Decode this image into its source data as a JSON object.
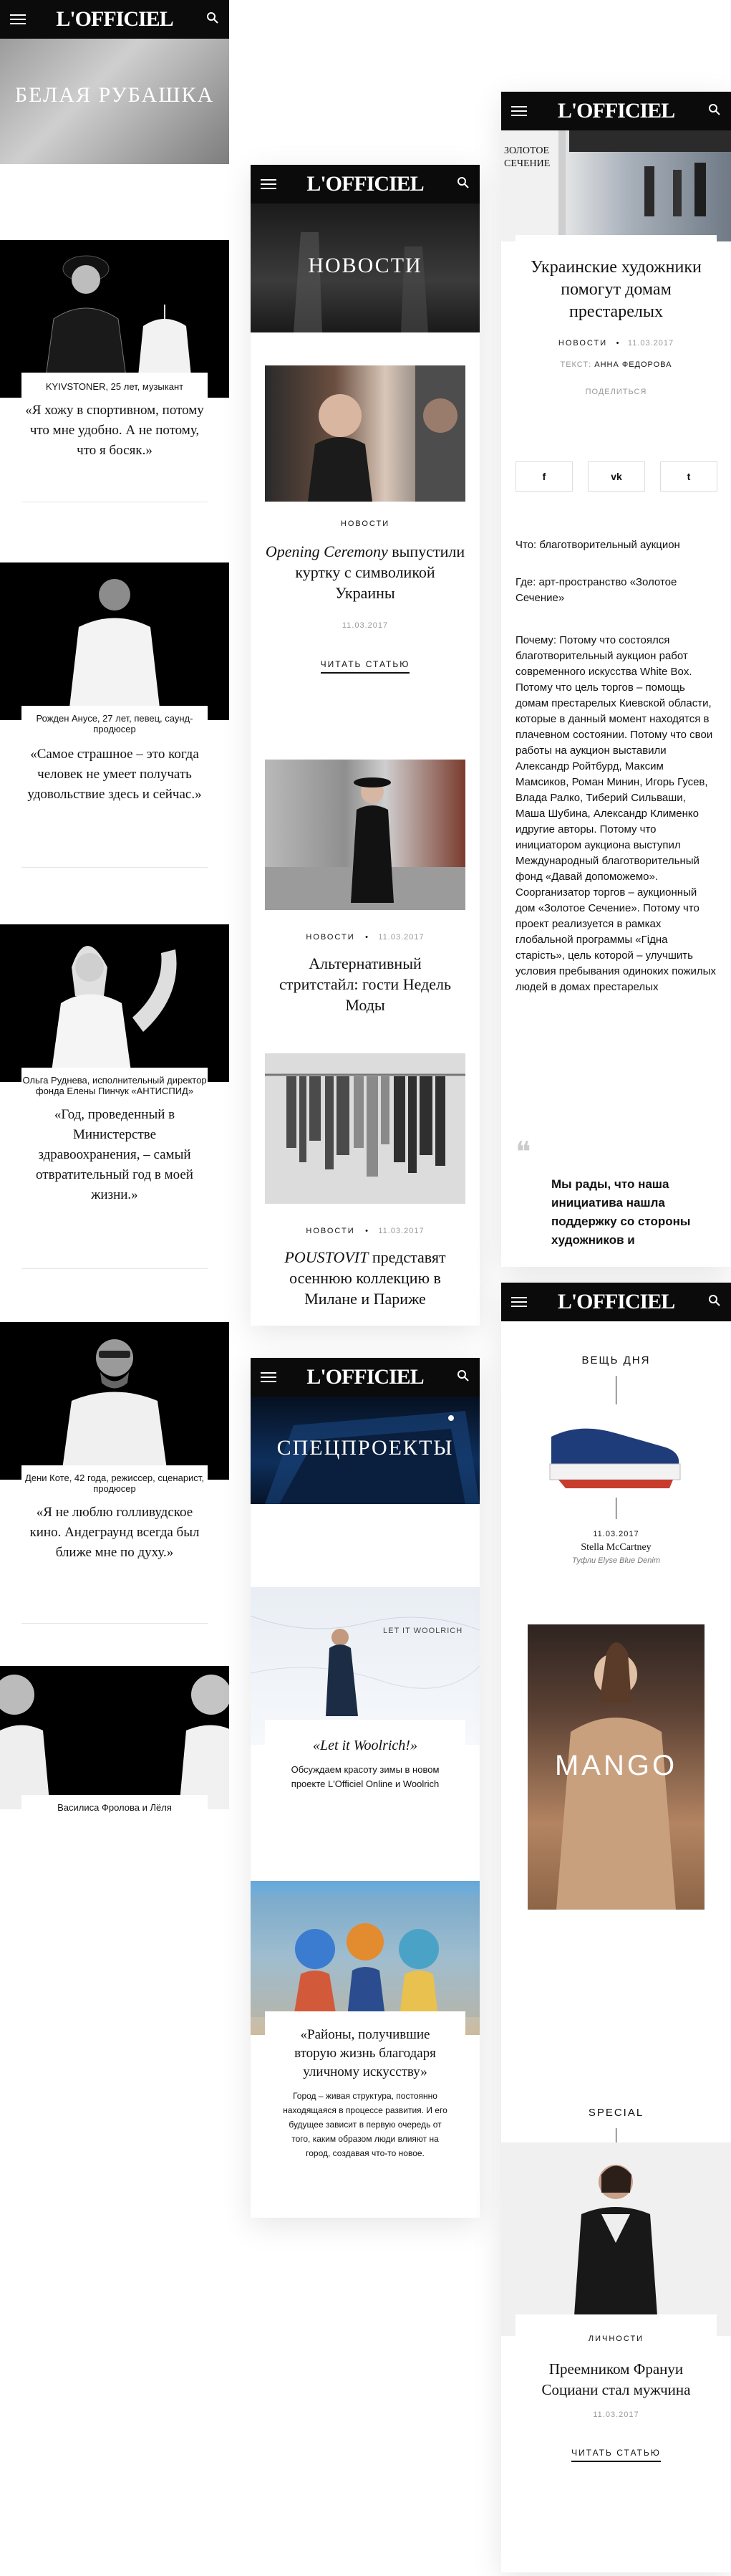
{
  "brand": {
    "logo": "L'OFFICIEL"
  },
  "phone1": {
    "hero_title": "БЕЛАЯ РУБАШКА",
    "items": [
      {
        "caption": "KYIVSTONER, 25 лет, музыкант",
        "quote": "«Я хожу в спортивном, потому что мне удобно. А не потому, что я босяк.»"
      },
      {
        "caption": "Рожден Анусе, 27 лет, певец, саунд-продюсер",
        "quote": "«Самое страшное – это когда человек не умеет получать удовольствие здесь и сейчас.»"
      },
      {
        "caption": "Ольга Руднева, исполнительный директор фонда Елены Пинчук «АНТИСПИД»",
        "quote": "«Год, проведенный в Министерстве здравоохранения, – самый отвратительный год в моей жизни.»"
      },
      {
        "caption": "Дени Коте, 42 года, режиссер, сценарист, продюсер",
        "quote": "«Я не люблю голливудское кино. Андеграунд всегда был ближе мне по духу.»"
      },
      {
        "caption": "Василиса Фролова и Лёля",
        "quote": ""
      }
    ]
  },
  "phone2": {
    "hero_title": "НОВОСТИ",
    "articles": [
      {
        "category": "НОВОСТИ",
        "date": "11.03.2017",
        "title_italic": "Opening Ceremony",
        "title": "выпустили куртку с символикой Украины",
        "read": "ЧИТАТЬ СТАТЬЮ"
      },
      {
        "category": "НОВОСТИ",
        "date": "11.03.2017",
        "title": "Альтернативный стритстайл: гости Недель Моды"
      },
      {
        "category": "НОВОСТИ",
        "date": "11.03.2017",
        "title_italic": "POUSTOVIT",
        "title": "представят осеннюю коллекцию в Милане и Париже"
      }
    ]
  },
  "phone3": {
    "hero_title": "СПЕЦПРОЕКТЫ",
    "woolrich_sign": "LET IT WOOLRICH",
    "items": [
      {
        "title": "«Let it Woolrich!»",
        "text": "Обсуждаем красоту зимы в новом проекте L'Officiel Online и Woolrich"
      },
      {
        "title": "«Районы, получившие вторую жизнь благодаря уличному искусству»",
        "text": "Город – живая структура, постоянно находящаяся в процессе развития. И его будущее зависит в первую очередь от того, каким образом люди влияют на город, создавая что-то новое."
      }
    ]
  },
  "phone4": {
    "hero_sign": "ЗОЛОТОЕ СЕЧЕНИЕ",
    "title": "Украинские художники помогут домам престарелых",
    "category": "НОВОСТИ",
    "date": "11.03.2017",
    "author_label": "ТЕКСТ:",
    "author": "АННА ФЕДОРОВА",
    "share_label": "ПОДЕЛИТЬСЯ",
    "share": {
      "fb": "f",
      "vk": "vk",
      "tw": "t"
    },
    "p1": "Что: благотворительный аукцион",
    "p2": "Где: арт-пространство «Золотое Сечение»",
    "p3": "Почему: Потому что состоялся благотворительный аукцион работ современного искусства White Box. Потому что цель торгов – помощь домам престарелых Киевской области, которые в данный момент находятся в плачевном состоянии. Потому что свои работы на аукцион выставили Александр Ройтбурд, Максим Мамсиков, Роман Минин, Игорь Гусев, Влада Ралко, Тиберий Сильваши, Маша Шубина, Александр Клименко идругие авторы. Потому что инициатором аукциона выступил Международный благотворительный фонд «Давай допоможемо». Соорганизатор торгов – аукционный дом «Золотое Сечение». Потому что проект реализуется в рамках глобальной программы «Гідна старість», цель которой – улучшить условия пребывания одиноких пожилых людей в домах престарелых",
    "quote_mark": "❝",
    "quote": "Мы рады, что наша инициатива нашла поддержку со стороны художников и"
  },
  "phone5": {
    "section": "ВЕЩЬ ДНЯ",
    "date": "11.03.2017",
    "brand": "Stella McCartney",
    "product": "Туфли Elyse Blue Denim",
    "ad": "MANGO",
    "special": "SPECIAL",
    "category": "ЛИЧНОСТИ",
    "title": "Преемником Франуи Социани стал мужчина",
    "date2": "11.03.2017",
    "read": "ЧИТАТЬ СТАТЬЮ"
  }
}
